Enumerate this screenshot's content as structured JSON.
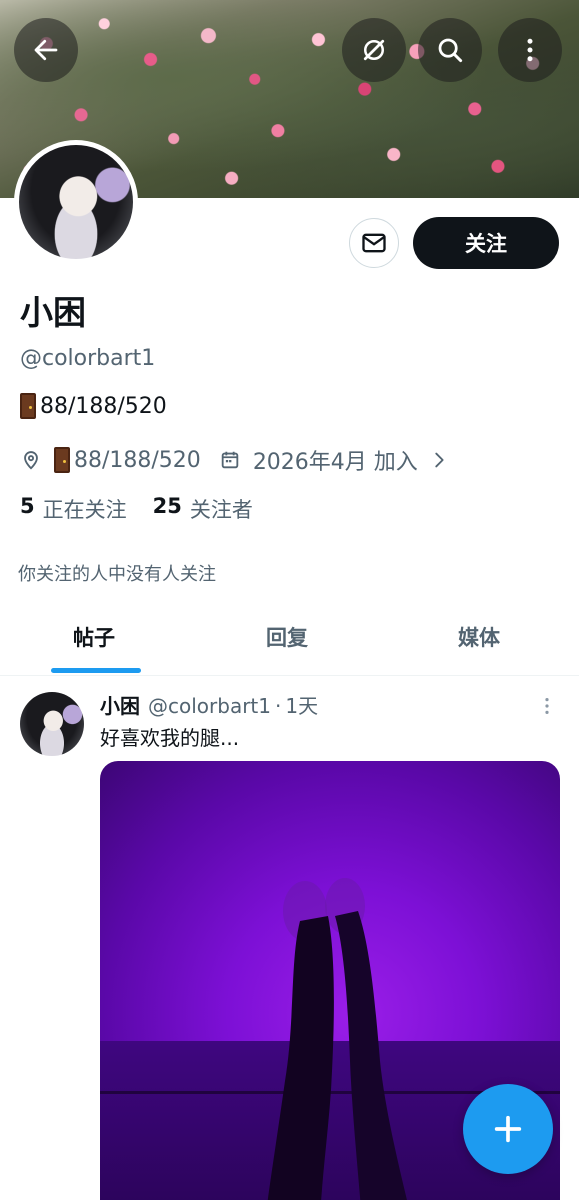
{
  "header": {
    "back_icon": "arrow-left-icon",
    "grok_icon": "grok-icon",
    "search_icon": "search-icon",
    "more_icon": "more-vertical-icon"
  },
  "profile": {
    "name": "小困",
    "handle": "@colorbart1",
    "bio": "88/188/520",
    "location": "88/188/520",
    "joined": "2026年4月 加入",
    "following_count": "5",
    "following_label": "正在关注",
    "followers_count": "25",
    "followers_label": "关注者",
    "followed_note": "你关注的人中没有人关注"
  },
  "actions": {
    "message_icon": "mail-icon",
    "follow_label": "关注"
  },
  "tabs": [
    {
      "label": "帖子",
      "active": true
    },
    {
      "label": "回复",
      "active": false
    },
    {
      "label": "媒体",
      "active": false
    }
  ],
  "post": {
    "name": "小困",
    "handle": "@colorbart1",
    "dot": "·",
    "time": "1天",
    "text": "好喜欢我的腿..."
  },
  "colors": {
    "accent": "#1d9bf0",
    "text_primary": "#0f1419",
    "text_secondary": "#536471",
    "follow_button": "#0f1419"
  },
  "fab_icon": "plus-icon"
}
